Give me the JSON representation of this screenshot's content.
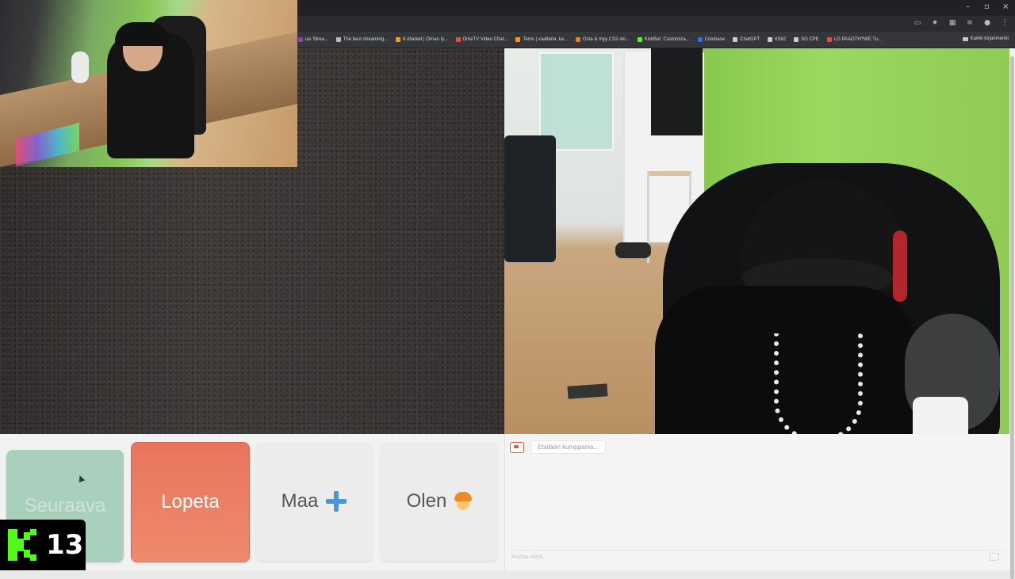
{
  "browser": {
    "bookmarks": [
      {
        "label": "ias Strea...",
        "color": "#8e44ad"
      },
      {
        "label": "The best streaming...",
        "color": "#bbbbbb"
      },
      {
        "label": "K-Market | Ornan ly...",
        "color": "#f39c12"
      },
      {
        "label": "OmeTV Video Chat...",
        "color": "#e74c3c"
      },
      {
        "label": "Tems | vaatteita, ka...",
        "color": "#f39c12"
      },
      {
        "label": "Osta & myy CS2-ski...",
        "color": "#e67e22"
      },
      {
        "label": "KickBot: Customiza...",
        "color": "#53fc18"
      },
      {
        "label": "Coinbase",
        "color": "#2e6bf6"
      },
      {
        "label": "ChatGPT",
        "color": "#cccccc"
      },
      {
        "label": "K562",
        "color": "#cccccc"
      },
      {
        "label": "SO CPE",
        "color": "#cccccc"
      },
      {
        "label": "LG PAAOTH?WE Tu...",
        "color": "#e74c3c"
      }
    ],
    "all_bookmarks_label": "Kaikki kirjanmerkit"
  },
  "controls": {
    "next_label": "Seuraava",
    "stop_label": "Lopeta",
    "country_label": "Maa",
    "gender_label": "Olen"
  },
  "chat": {
    "status_text": "Etsitään kumppania...",
    "input_placeholder": "Kirjoita viesti..."
  },
  "kick": {
    "viewer_count": "13"
  }
}
